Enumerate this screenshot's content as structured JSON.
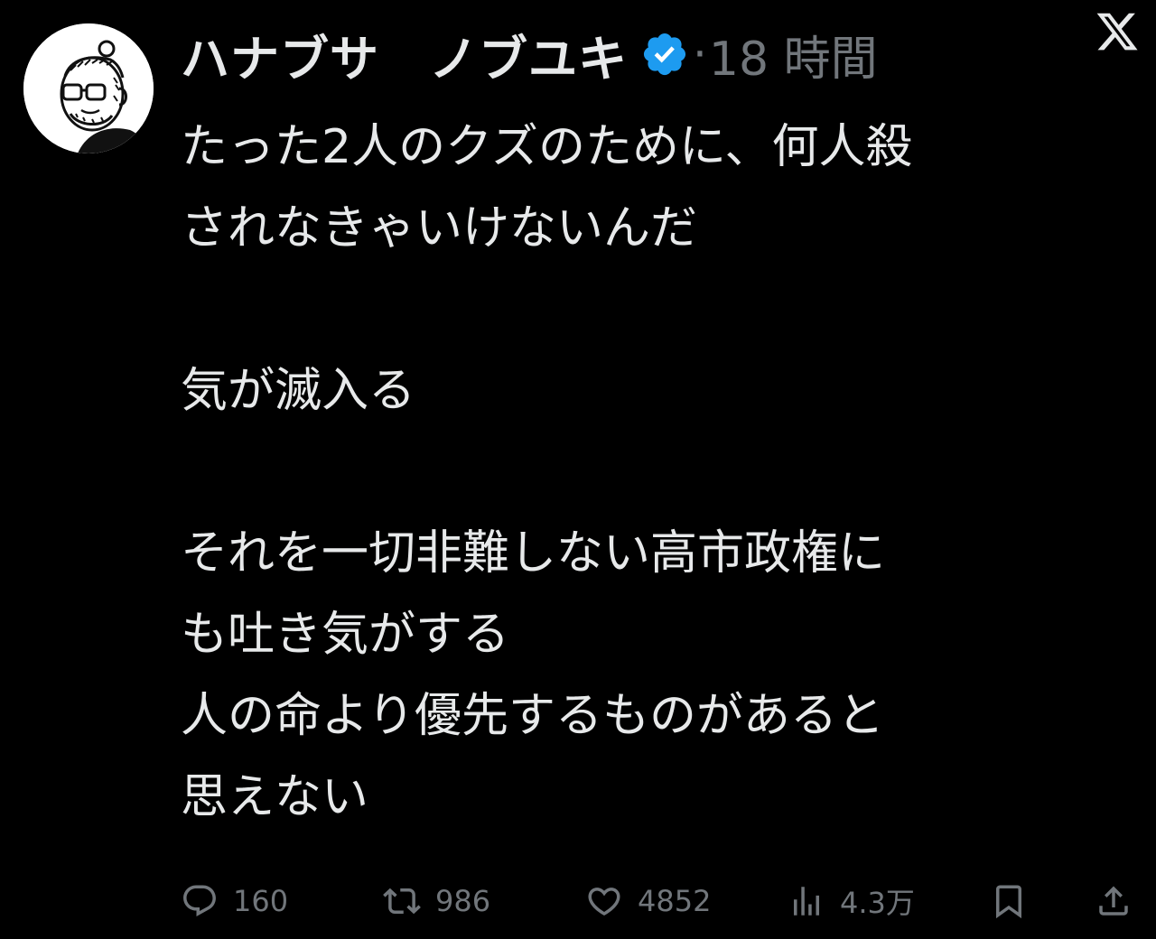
{
  "tweet": {
    "display_name": "ハナブサ　ノブユキ",
    "separator": "·",
    "time": "18 時間",
    "text": "たった2人のクズのために、何人殺\nされなきゃいけないんだ\n\n気が滅入る\n\nそれを一切非難しない高市政権に\nも吐き気がする\n人の命より優先するものがあると\n思えない"
  },
  "icons": {
    "verified": "verified-badge-icon",
    "platform": "x-logo-icon"
  },
  "actions": {
    "replies": "160",
    "reposts": "986",
    "likes": "4852",
    "views": "4.3万"
  },
  "colors": {
    "background": "#000000",
    "text": "#e7e9ea",
    "muted": "#71767b",
    "verified": "#1d9bf0"
  }
}
